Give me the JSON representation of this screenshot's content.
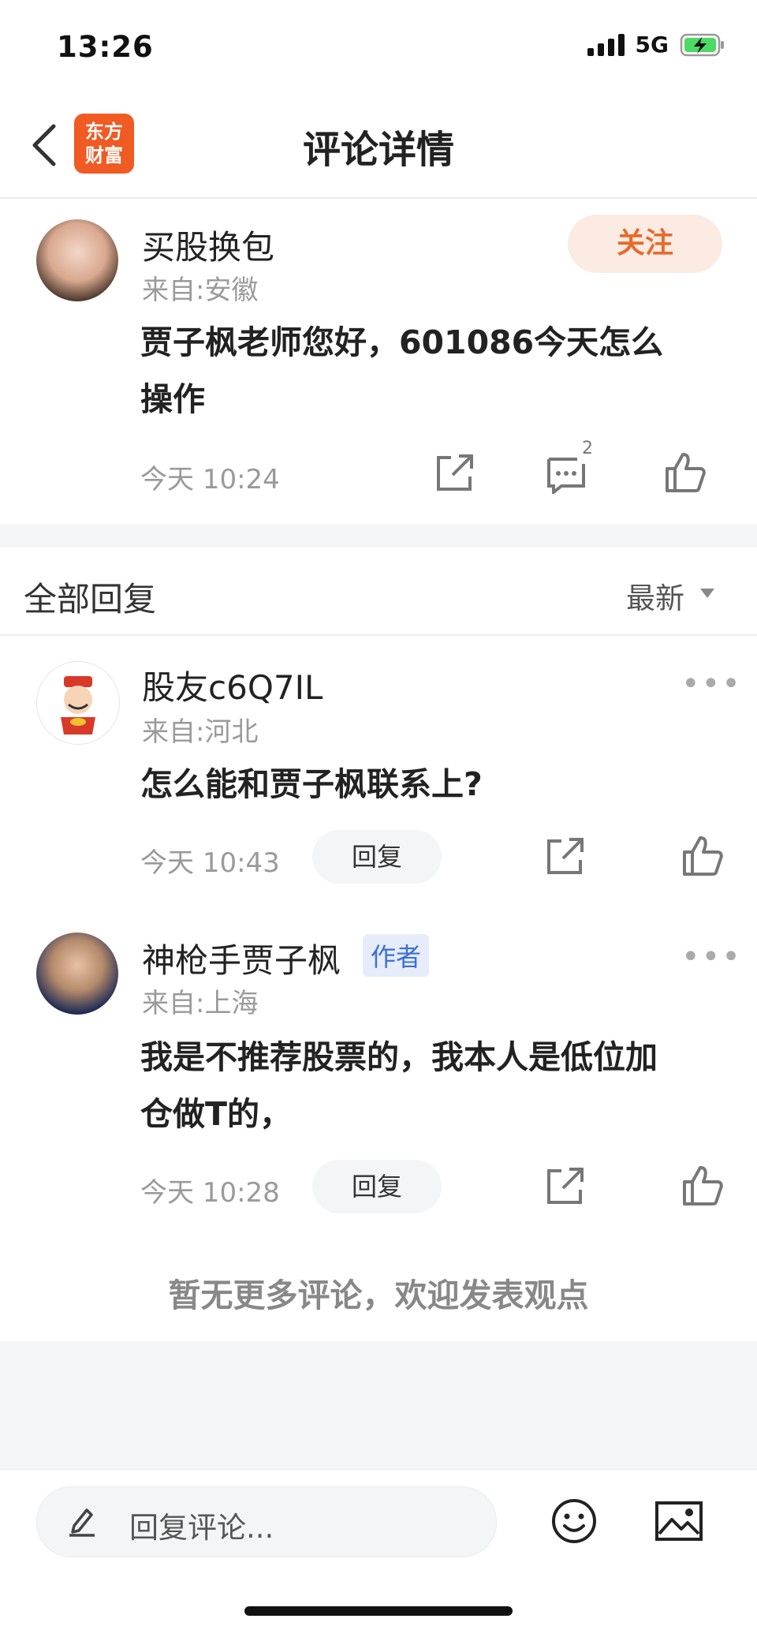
{
  "status_bar": {
    "time": "13:26",
    "network": "5G"
  },
  "nav": {
    "title": "评论详情",
    "logo_line1": "东方",
    "logo_line2": "财富"
  },
  "main_comment": {
    "user_name": "买股换包",
    "location": "来自:安徽",
    "follow_label": "关注",
    "content_line1": "贾子枫老师您好，601086今天怎么",
    "content_line2": "操作",
    "time": "今天 10:24",
    "comment_count": "2"
  },
  "replies_header": {
    "title": "全部回复",
    "sort_label": "最新"
  },
  "replies": [
    {
      "user_name": "股友c6Q7IL",
      "location": "来自:河北",
      "content": "怎么能和贾子枫联系上?",
      "time": "今天 10:43",
      "reply_label": "回复"
    },
    {
      "user_name": "神枪手贾子枫",
      "author_tag": "作者",
      "location": "来自:上海",
      "content_line1": "我是不推荐股票的，我本人是低位加",
      "content_line2": "仓做T的，",
      "time": "今天 10:28",
      "reply_label": "回复"
    }
  ],
  "no_more_text": "暂无更多评论，欢迎发表观点",
  "bottom_bar": {
    "input_placeholder": "回复评论..."
  },
  "colors": {
    "brand": "#f05a23",
    "follow_text": "#e86a2c",
    "follow_bg": "#fcebe2",
    "author_tag": "#3b6fd8"
  }
}
